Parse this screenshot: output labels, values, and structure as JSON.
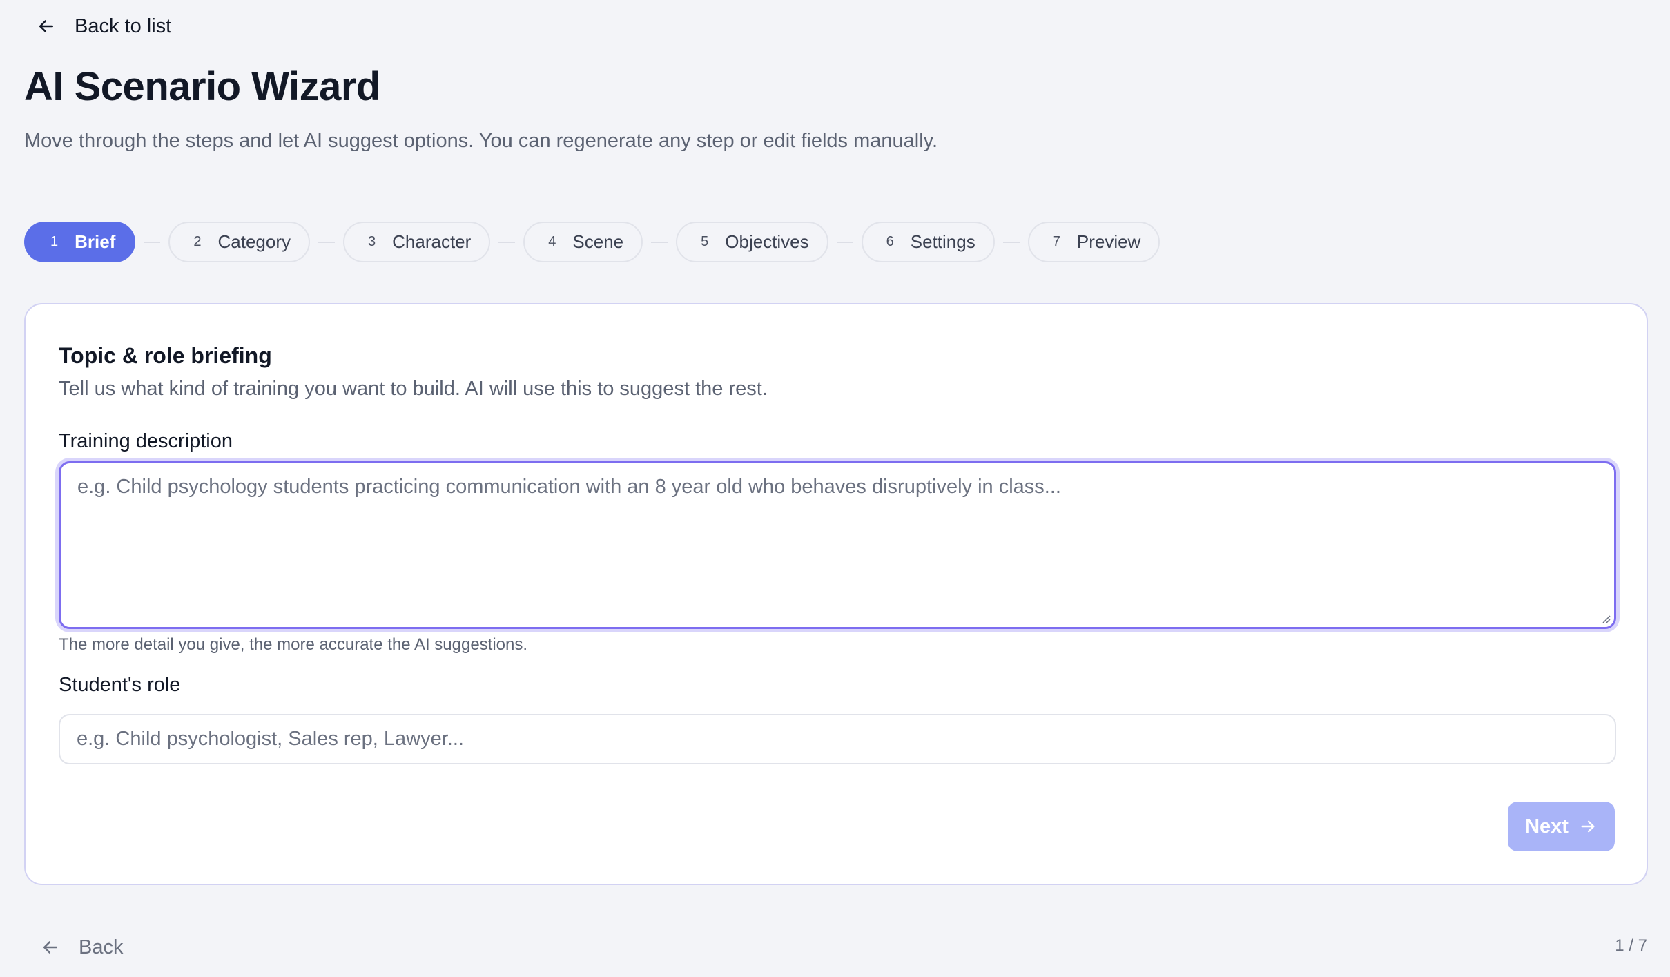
{
  "header": {
    "back_label": "Back to list",
    "title": "AI Scenario Wizard",
    "subtitle": "Move through the steps and let AI suggest options. You can regenerate any step or edit fields manually."
  },
  "steps": [
    {
      "num": "1",
      "label": "Brief",
      "active": true
    },
    {
      "num": "2",
      "label": "Category",
      "active": false
    },
    {
      "num": "3",
      "label": "Character",
      "active": false
    },
    {
      "num": "4",
      "label": "Scene",
      "active": false
    },
    {
      "num": "5",
      "label": "Objectives",
      "active": false
    },
    {
      "num": "6",
      "label": "Settings",
      "active": false
    },
    {
      "num": "7",
      "label": "Preview",
      "active": false
    }
  ],
  "card": {
    "title": "Topic & role briefing",
    "description": "Tell us what kind of training you want to build. AI will use this to suggest the rest.",
    "training": {
      "label": "Training description",
      "value": "",
      "placeholder": "e.g. Child psychology students practicing communication with an 8 year old who behaves disruptively in class...",
      "hint": "The more detail you give, the more accurate the AI suggestions."
    },
    "role": {
      "label": "Student's role",
      "value": "",
      "placeholder": "e.g. Child psychologist, Sales rep, Lawyer..."
    },
    "next_label": "Next"
  },
  "footer": {
    "back_label": "Back",
    "page_count": "1 / 7"
  },
  "colors": {
    "accent": "#5b6ee8",
    "focus_ring": "#7d6df0",
    "next_disabled": "#a9b4f8"
  },
  "icons": {
    "back": "arrow-left-icon",
    "next": "arrow-right-icon"
  }
}
